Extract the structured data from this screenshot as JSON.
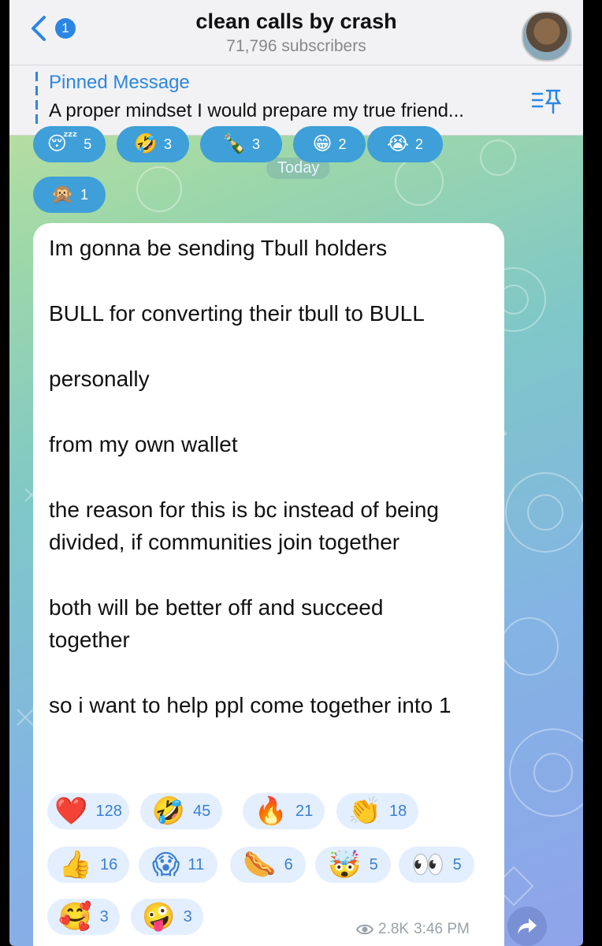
{
  "header": {
    "back_count": "1",
    "title": "clean calls by crash",
    "subtitle": "71,796 subscribers"
  },
  "pinned": {
    "label": "Pinned Message",
    "text": "A proper mindset I would prepare my true friend..."
  },
  "date_separator": "Today",
  "top_reactions": [
    {
      "emoji": "😴",
      "count": "5"
    },
    {
      "emoji": "🤣",
      "count": "3"
    },
    {
      "emoji": "🍾",
      "count": "3"
    },
    {
      "emoji": "😁",
      "count": "2"
    },
    {
      "emoji": "😭",
      "count": "2"
    },
    {
      "emoji": "🙊",
      "count": "1"
    }
  ],
  "message": {
    "paragraphs": [
      "Im gonna be sending Tbull holders",
      "BULL for converting their tbull to BULL",
      "personally",
      "from my own wallet",
      "the reason for this is bc instead of being divided, if communities join together",
      "both will be better off and succeed together",
      "so i want to help ppl come together into 1"
    ],
    "reactions": [
      {
        "emoji": "❤️",
        "count": "128"
      },
      {
        "emoji": "🤣",
        "count": "45"
      },
      {
        "emoji": "🔥",
        "count": "21"
      },
      {
        "emoji": "👏",
        "count": "18"
      },
      {
        "emoji": "👍",
        "count": "16"
      },
      {
        "emoji": "😱",
        "count": "11"
      },
      {
        "emoji": "🌭",
        "count": "6"
      },
      {
        "emoji": "🤯",
        "count": "5"
      },
      {
        "emoji": "👀",
        "count": "5"
      },
      {
        "emoji": "🥰",
        "count": "3"
      },
      {
        "emoji": "🤪",
        "count": "3"
      }
    ],
    "views": "2.8K",
    "time": "3:46 PM"
  },
  "icons": [
    "back-chevron-icon",
    "pin-list-icon",
    "eye-icon",
    "share-arrow-icon"
  ],
  "colors": {
    "accent": "#2b86e3",
    "reaction_bg": "#e3efff",
    "reaction_text": "#3b7fd0"
  }
}
